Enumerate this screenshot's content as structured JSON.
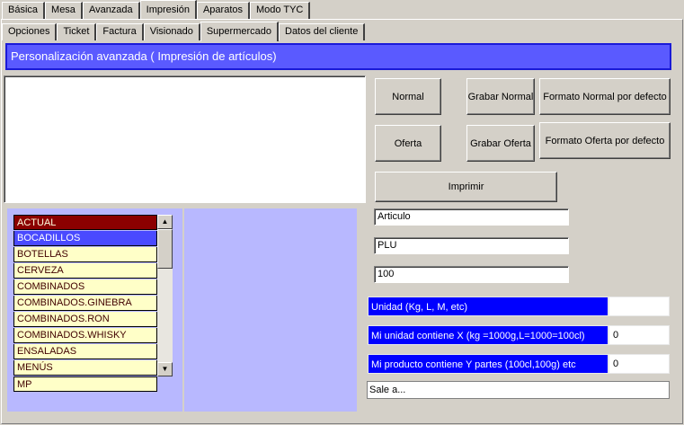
{
  "tabs_top": [
    "Básica",
    "Mesa",
    "Avanzada",
    "Impresión",
    "Aparatos",
    "Modo TYC"
  ],
  "tabs_sub": [
    "Opciones",
    "Ticket",
    "Factura",
    "Visionado",
    "Supermercado",
    "Datos del cliente"
  ],
  "header": "Personalización avanzada ( Impresión de artículos)",
  "buttons": {
    "normal": "Normal",
    "grabar_normal": "Grabar Normal",
    "formato_normal": "Formato Normal por defecto",
    "oferta": "Oferta",
    "grabar_oferta": "Grabar Oferta",
    "formato_oferta": "Formato Oferta por defecto",
    "imprimir": "Imprimir"
  },
  "fields": {
    "articulo": "Articulo",
    "plu": "PLU",
    "cantidad": "100"
  },
  "params": [
    {
      "label": "Unidad (Kg, L, M,  etc)",
      "value": ""
    },
    {
      "label": "Mi unidad contiene X (kg =1000g,L=1000=100cl)",
      "value": "0"
    },
    {
      "label": "Mi producto contiene Y partes (100cl,100g) etc",
      "value": "0"
    }
  ],
  "sale_field": "Sale a...",
  "list_items": [
    "ACTUAL",
    "BOCADILLOS",
    "BOTELLAS",
    "CERVEZA",
    "COMBINADOS",
    "COMBINADOS.GINEBRA",
    "COMBINADOS.RON",
    "COMBINADOS.WHISKY",
    "ENSALADAS",
    "MENÚS",
    "MP"
  ],
  "active_tab_top": "Impresión",
  "active_tab_sub": "Supermercado",
  "colors": {
    "header_bg": "#5a5aff",
    "label_blue": "#0000ff",
    "list_bg": "#ffffc8",
    "list_actual": "#8b0000",
    "list_selected": "#4a4aff",
    "lilac": "#b8b8ff"
  }
}
